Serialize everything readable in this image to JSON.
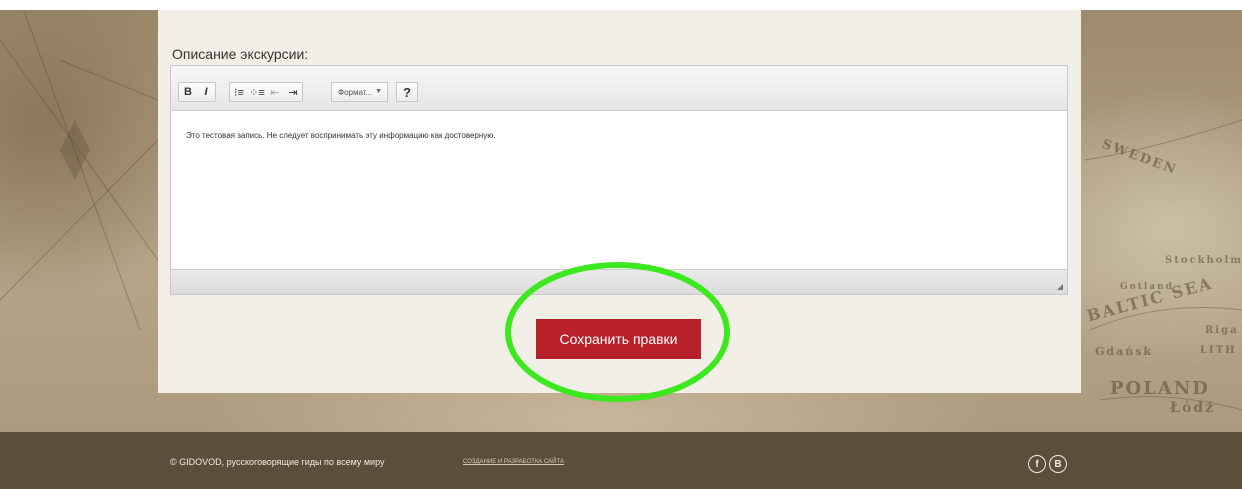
{
  "form": {
    "description_label": "Описание экскурсии:",
    "editor": {
      "toolbar": {
        "bold": "B",
        "italic": "I",
        "ordered_list": "⁝≡",
        "unordered_list": "⁘≡",
        "outdent": "⇤",
        "indent": "⇥",
        "format_select": "Формат...",
        "help": "?"
      },
      "content": "Это тестовая запись. Не следует воспринимать эту информацию как достоверную."
    },
    "save_button": "Сохранить правки"
  },
  "footer": {
    "copyright": "© GIDOVOD, русскоговорящие гиды по всему миру",
    "dev_link": "СОЗДАНИЕ И РАЗРАБОТКА САЙТА",
    "social": {
      "facebook": "f",
      "vk": "B"
    }
  },
  "background_map_labels": [
    "SWEDEN",
    "Stockholm",
    "Gotland",
    "BALTIC SEA",
    "Gdańsk",
    "POLAND",
    "Łódź",
    "Riga",
    "LITH"
  ],
  "colors": {
    "save_button": "#b8202a",
    "highlight": "#3ce81e",
    "footer": "#5b4e3a",
    "panel": "#f2f0e6"
  }
}
